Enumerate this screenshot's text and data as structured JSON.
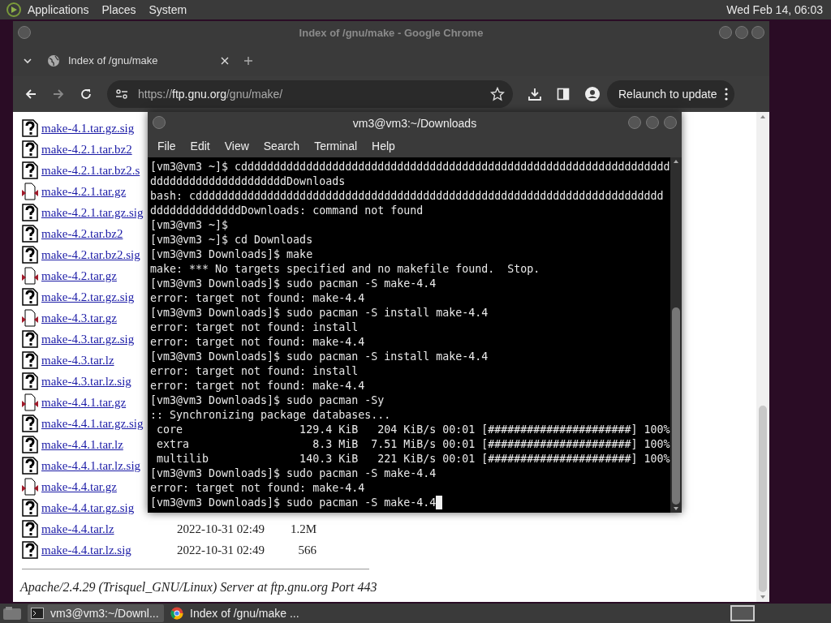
{
  "top_panel": {
    "menus": [
      "Applications",
      "Places",
      "System"
    ],
    "clock": "Wed Feb 14, 06:03"
  },
  "browser": {
    "window_title": "Index of /gnu/make - Google Chrome",
    "tabs": [
      {
        "label": "Index of /gnu/make",
        "selected": true
      }
    ],
    "address": {
      "scheme": "https://",
      "host": "ftp.gnu.org",
      "path": "/gnu/make/"
    },
    "relaunch_button": "Relaunch to update",
    "listing": [
      {
        "kind": "unknown",
        "name": "make-4.1.tar.gz.sig"
      },
      {
        "kind": "unknown",
        "name": "make-4.2.1.tar.bz2"
      },
      {
        "kind": "unknown",
        "name": "make-4.2.1.tar.bz2.s"
      },
      {
        "kind": "compressed",
        "name": "make-4.2.1.tar.gz"
      },
      {
        "kind": "unknown",
        "name": "make-4.2.1.tar.gz.sig"
      },
      {
        "kind": "unknown",
        "name": "make-4.2.tar.bz2"
      },
      {
        "kind": "unknown",
        "name": "make-4.2.tar.bz2.sig"
      },
      {
        "kind": "compressed",
        "name": "make-4.2.tar.gz"
      },
      {
        "kind": "unknown",
        "name": "make-4.2.tar.gz.sig"
      },
      {
        "kind": "compressed",
        "name": "make-4.3.tar.gz"
      },
      {
        "kind": "unknown",
        "name": "make-4.3.tar.gz.sig"
      },
      {
        "kind": "unknown",
        "name": "make-4.3.tar.lz"
      },
      {
        "kind": "unknown",
        "name": "make-4.3.tar.lz.sig"
      },
      {
        "kind": "compressed",
        "name": "make-4.4.1.tar.gz"
      },
      {
        "kind": "unknown",
        "name": "make-4.4.1.tar.gz.sig"
      },
      {
        "kind": "unknown",
        "name": "make-4.4.1.tar.lz"
      },
      {
        "kind": "unknown",
        "name": "make-4.4.1.tar.lz.sig"
      },
      {
        "kind": "compressed",
        "name": "make-4.4.tar.gz"
      },
      {
        "kind": "unknown",
        "name": "make-4.4.tar.gz.sig"
      },
      {
        "kind": "unknown",
        "name": "make-4.4.tar.lz",
        "modified": "2022-10-31 02:49",
        "size": "1.2M"
      },
      {
        "kind": "unknown",
        "name": "make-4.4.tar.lz.sig",
        "modified": "2022-10-31 02:49",
        "size": "566"
      }
    ],
    "footer": "Apache/2.4.29 (Trisquel_GNU/Linux) Server at ftp.gnu.org Port 443"
  },
  "terminal": {
    "window_title": "vm3@vm3:~/Downloads",
    "menus": [
      "File",
      "Edit",
      "View",
      "Search",
      "Terminal",
      "Help"
    ],
    "cursor": true,
    "lines": [
      "[vm3@vm3 ~]$ cdddddddddddddddddddddddddddddddddddddddddddddddddddddddddddddddddd",
      "dddddddddddddddddddddDownloads",
      "bash: cdddddddddddddddddddddddddddddddddddddddddddddddddddddddddddddddddddddddd",
      "ddddddddddddddDownloads: command not found",
      "[vm3@vm3 ~]$",
      "[vm3@vm3 ~]$ cd Downloads",
      "[vm3@vm3 Downloads]$ make",
      "make: *** No targets specified and no makefile found.  Stop.",
      "[vm3@vm3 Downloads]$ sudo pacman -S make-4.4",
      "error: target not found: make-4.4",
      "[vm3@vm3 Downloads]$ sudo pacman -S install make-4.4",
      "error: target not found: install",
      "error: target not found: make-4.4",
      "[vm3@vm3 Downloads]$ sudo pacman -S install make-4.4",
      "error: target not found: install",
      "error: target not found: make-4.4",
      "[vm3@vm3 Downloads]$ sudo pacman -Sy",
      ":: Synchronizing package databases...",
      " core                  129.4 KiB   204 KiB/s 00:01 [######################] 100%",
      " extra                   8.3 MiB  7.51 MiB/s 00:01 [######################] 100%",
      " multilib              140.3 KiB   221 KiB/s 00:01 [######################] 100%",
      "[vm3@vm3 Downloads]$ sudo pacman -S make-4.4",
      "error: target not found: make-4.4",
      "[vm3@vm3 Downloads]$ sudo pacman -S make-4.4"
    ]
  },
  "taskbar": [
    {
      "label": "vm3@vm3:~/Downl...",
      "kind": "terminal",
      "selected": true
    },
    {
      "label": "Index of /gnu/make ...",
      "kind": "browser",
      "selected": false
    }
  ]
}
